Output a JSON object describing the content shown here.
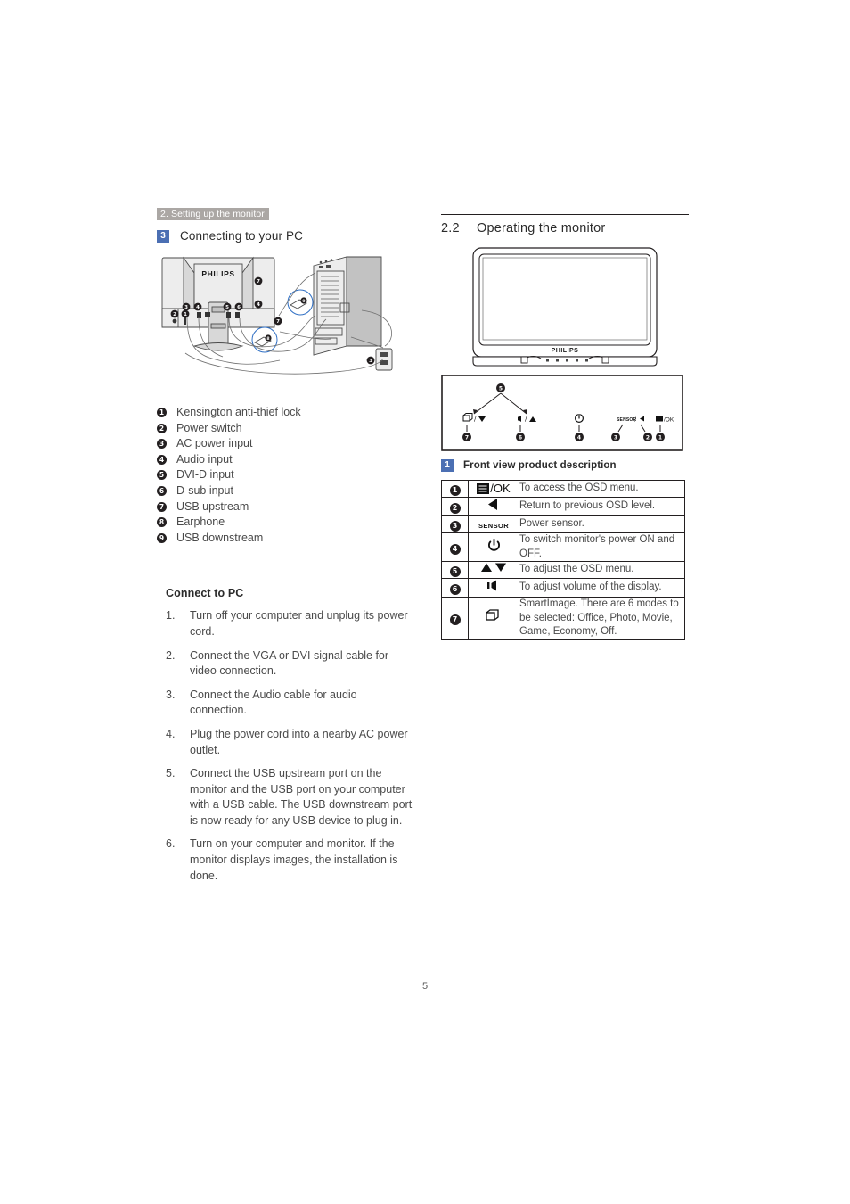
{
  "page": {
    "number": "5",
    "running_header": "2. Setting up the monitor",
    "accent_blue": "#4b6fb3",
    "header_band_gray": "#aba7a4"
  },
  "left": {
    "section": {
      "badge": "3",
      "title": "Connecting to your PC"
    },
    "figure": {
      "name": "monitor-pc-connection-diagram",
      "brand_label": "PHILIPS",
      "callouts": [
        "1",
        "2",
        "3",
        "4",
        "5",
        "6",
        "7",
        "8",
        "9"
      ]
    },
    "ports": [
      {
        "n": "1",
        "label": "Kensington anti-thief lock"
      },
      {
        "n": "2",
        "label": "Power switch"
      },
      {
        "n": "3",
        "label": "AC power input"
      },
      {
        "n": "4",
        "label": "Audio input"
      },
      {
        "n": "5",
        "label": "DVI-D input"
      },
      {
        "n": "6",
        "label": "D-sub input"
      },
      {
        "n": "7",
        "label": "USB upstream"
      },
      {
        "n": "8",
        "label": "Earphone"
      },
      {
        "n": "9",
        "label": "USB downstream"
      }
    ],
    "connect_heading": "Connect to PC",
    "steps": [
      {
        "n": "1.",
        "text": "Turn off your computer and unplug its power cord."
      },
      {
        "n": "2.",
        "text": "Connect the VGA or DVI signal cable for video connection."
      },
      {
        "n": "3.",
        "text": "Connect the Audio cable for audio connection."
      },
      {
        "n": "4.",
        "text": "Plug the power cord into a nearby AC power outlet."
      },
      {
        "n": "5.",
        "text": "Connect the USB upstream port on the monitor and the USB port on your computer with a USB cable. The USB downstream port is now ready for any USB device to plug in."
      },
      {
        "n": "6.",
        "text": "Turn on your computer and monitor. If the monitor displays images, the installation is done."
      }
    ]
  },
  "right": {
    "section": {
      "number": "2.2",
      "title": "Operating the monitor"
    },
    "monitor_figure": {
      "name": "monitor-front-view",
      "brand_label": "PHILIPS"
    },
    "bezel_figure": {
      "name": "front-bezel-controls-diagram",
      "controls": [
        {
          "n": "7",
          "glyph": "SmartImage / ▼"
        },
        {
          "n": "6",
          "glyph": "volume / ▲"
        },
        {
          "n": "5",
          "glyph": "up-down"
        },
        {
          "n": "4",
          "glyph": "power"
        },
        {
          "n": "3",
          "glyph": "SENSOR"
        },
        {
          "n": "2",
          "glyph": "◀"
        },
        {
          "n": "1",
          "glyph": "menu / OK"
        }
      ]
    },
    "table_heading": {
      "badge": "1",
      "title": "Front view product description"
    },
    "table_rows": [
      {
        "n": "1",
        "icon": "osd-menu-ok-icon",
        "icon_text": "/OK",
        "desc": "To access the OSD menu."
      },
      {
        "n": "2",
        "icon": "left-arrow-icon",
        "icon_text": "◀",
        "desc": "Return to previous OSD level."
      },
      {
        "n": "3",
        "icon": "sensor-icon",
        "icon_text": "SENSOR",
        "desc": "Power sensor."
      },
      {
        "n": "4",
        "icon": "power-icon",
        "icon_text": "⏻",
        "desc": "To switch monitor's power ON and OFF."
      },
      {
        "n": "5",
        "icon": "up-down-arrow-icon",
        "icon_text": "▲▼",
        "desc": "To adjust the OSD menu."
      },
      {
        "n": "6",
        "icon": "volume-icon",
        "icon_text": "ᐅ◁",
        "desc": "To adjust volume of the display."
      },
      {
        "n": "7",
        "icon": "smartimage-icon",
        "icon_text": "❐",
        "desc": "SmartImage. There are 6 modes to be selected: Office, Photo, Movie, Game, Economy, Off."
      }
    ]
  }
}
